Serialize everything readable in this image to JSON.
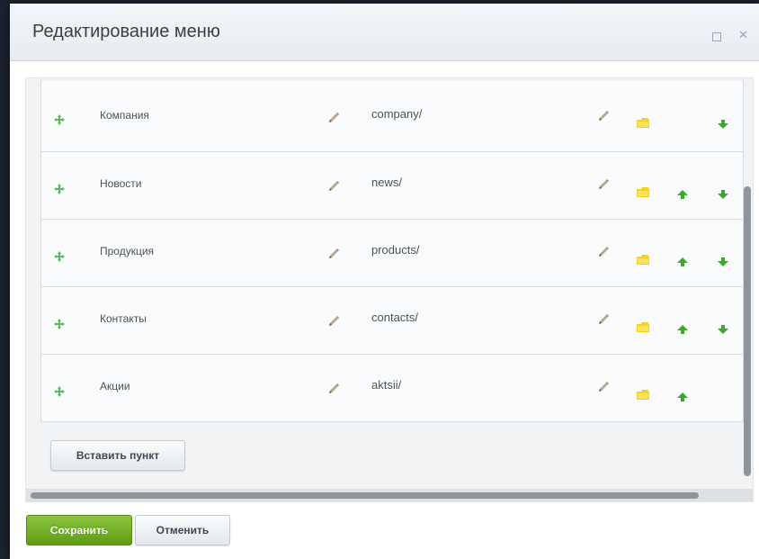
{
  "dialog": {
    "title": "Редактирование меню"
  },
  "menu_items": [
    {
      "name": "Компания",
      "url": "company/",
      "has_up": false,
      "has_down": true
    },
    {
      "name": "Новости",
      "url": "news/",
      "has_up": true,
      "has_down": true
    },
    {
      "name": "Продукция",
      "url": "products/",
      "has_up": true,
      "has_down": true
    },
    {
      "name": "Контакты",
      "url": "contacts/",
      "has_up": true,
      "has_down": true
    },
    {
      "name": "Акции",
      "url": "aktsii/",
      "has_up": true,
      "has_down": false
    }
  ],
  "buttons": {
    "insert_item": "Вставить пункт",
    "save": "Сохранить",
    "cancel": "Отменить"
  },
  "colors": {
    "accent_green": "#6aaa1e",
    "arrow_green": "#3fa82c",
    "folder_yellow": "#f4d21f"
  },
  "icons": {
    "drag": "drag-handle-icon",
    "edit": "pencil-icon",
    "folder": "folder-icon",
    "up": "arrow-up-icon",
    "down": "arrow-down-icon"
  }
}
